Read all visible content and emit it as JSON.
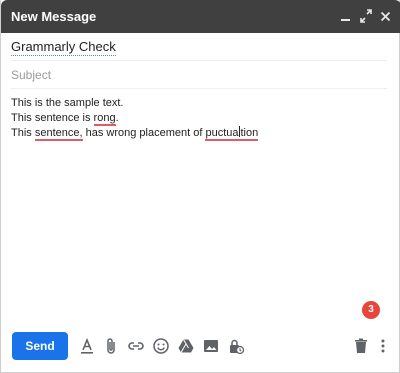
{
  "window": {
    "title": "New Message"
  },
  "to": {
    "recipient": "Grammarly Check"
  },
  "subject": {
    "placeholder": "Subject",
    "value": ""
  },
  "body": {
    "line1": "This is the sample text.",
    "line2_a": "This sentence is ",
    "line2_err": "rong",
    "line2_b": ".",
    "line3_a": "This ",
    "line3_err1": "sentence,",
    "line3_b": " has wrong placement of ",
    "line3_err2a": "puctua",
    "line3_err2b": "tion"
  },
  "grammarly": {
    "issue_count": "3",
    "badge_color": "#e6463b",
    "underline_color": "#e05a67"
  },
  "toolbar": {
    "send_label": "Send",
    "send_color": "#1a73e8",
    "icons": [
      "format-text-icon",
      "attach-icon",
      "link-icon",
      "emoji-icon",
      "drive-icon",
      "photo-icon",
      "confidential-icon",
      "trash-icon",
      "more-vert-icon"
    ]
  },
  "titlebar": {
    "bg_color": "#404040",
    "controls": [
      "minimize-icon",
      "expand-icon",
      "close-icon"
    ]
  }
}
